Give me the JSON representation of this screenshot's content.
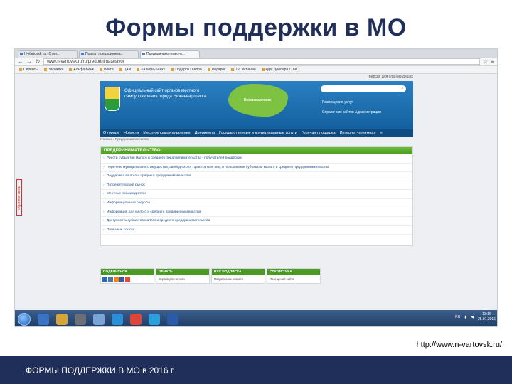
{
  "slide": {
    "title": "Формы поддержки в МО",
    "url_caption": "http://www.n-vartovsk.ru/",
    "footer_text": "ФОРМЫ ПОДДЕРЖКИ В МО в 2016 г."
  },
  "browser": {
    "tabs": [
      "Н-Vartovsk ru : Стан...",
      "Портал предпринима...",
      "Предпринимательств..."
    ],
    "active_tab": 2,
    "address": "www.n-vartovsk.ru/ru/predprinimatelstvo/",
    "bookmarks": [
      "Сервисы",
      "Закладки",
      "Альфа-Банк",
      "Почта",
      "ЦАИ",
      "«Альфа-Банк»",
      "Подарок Генпро",
      "Подарок",
      "12. Испания",
      "курс Доллара США"
    ]
  },
  "site": {
    "top_link": "Версия для слабовидящих",
    "brand_text": "Официальный сайт органов местного самоуправления города Нижневартовска",
    "map_label": "Нижневартовск",
    "search_placeholder": "",
    "header_links": [
      "Размещение услуг",
      "Справочник сайтов Администрации"
    ],
    "nav": [
      "О городе",
      "Новости",
      "Местное самоуправление",
      "Документы",
      "Государственные и муниципальные услуги",
      "Горячая площадка",
      "Интернет-приемная",
      "≡"
    ],
    "breadcrumb": "Главная / Предпринимательство",
    "panel_title": "ПРЕДПРИНИМАТЕЛЬСТВО",
    "items": [
      "Реестр субъектов малого и среднего предпринимательства - получателей поддержки",
      "Перечень муниципального имущества, свободного от прав третьих лиц, в пользование субъектам малого и среднего предпринимательства",
      "Поддержка малого и среднего предпринимательства",
      "Потребительский рынок",
      "Местные производители",
      "Информационные ресурсы",
      "Информация для малого и среднего предпринимательства",
      "Доступность субъектов малого и среднего предпринимательства",
      "Полезные ссылки"
    ],
    "side_tab": "Обратная связь",
    "footer_blocks": [
      {
        "title": "ПОДЕЛИТЬСЯ",
        "body": ""
      },
      {
        "title": "ПЕЧАТЬ",
        "body": "Версия для печати"
      },
      {
        "title": "RSS ПОДПИСКА",
        "body": "Подписка на новости"
      },
      {
        "title": "СТАТИСТИКА",
        "body": "Посещений сайта"
      }
    ]
  },
  "taskbar": {
    "lang": "RU",
    "time": "13:16",
    "date": "25.01.2016"
  },
  "colors": {
    "title": "#1f2f5a",
    "header_blue": "#1d6fb0",
    "green": "#5cae2e",
    "share_colors": [
      "#2a6ab8",
      "#4a76a8",
      "#f58220",
      "#3b5998",
      "#dd4b39"
    ]
  }
}
